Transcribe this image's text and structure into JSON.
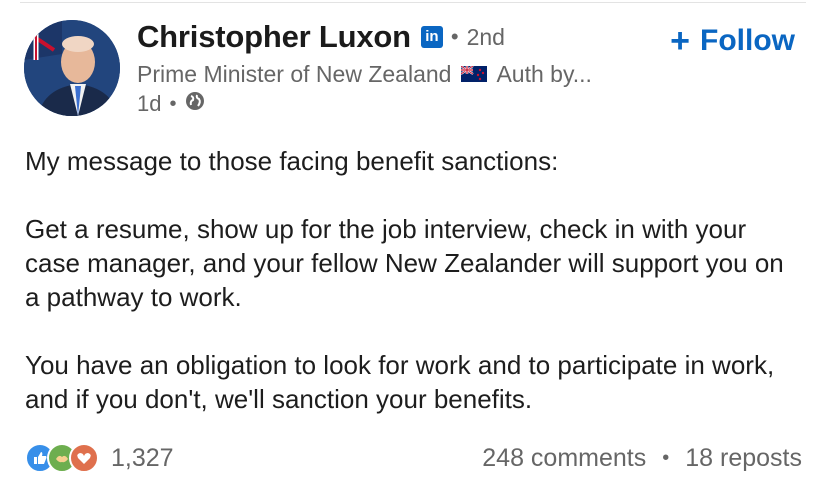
{
  "post": {
    "author": {
      "name": "Christopher Luxon",
      "degree": "2nd",
      "separator": "•",
      "headline": "Prime Minister of New Zealand",
      "headline_suffix": "Auth by...",
      "avatar_icon": "profile-photo",
      "badge_icon": "linkedin-icon",
      "badge_text": "in"
    },
    "follow_label": "Follow",
    "follow_icon": "plus-icon",
    "timestamp": "1d",
    "visibility_icon": "globe-icon",
    "flag_icon": "nz-flag-icon",
    "paragraphs": [
      "My message to those facing benefit sanctions:",
      "Get a resume, show up for the job interview, check in with your case manager, and your fellow New Zealander will support you on a pathway to work.",
      "You have an obligation to look for work and to participate in work, and if you don't, we'll sanction your benefits."
    ],
    "reactions": {
      "icons": [
        "like-icon",
        "support-icon",
        "love-icon"
      ],
      "count": "1,327"
    },
    "comments": "248 comments",
    "reposts": "18 reposts",
    "stats_separator": "•"
  },
  "colors": {
    "accent": "#0a66c2",
    "text": "#1d1d1d",
    "muted": "#666666",
    "like": "#378fe9",
    "support": "#6dae4f",
    "love": "#df704d"
  }
}
